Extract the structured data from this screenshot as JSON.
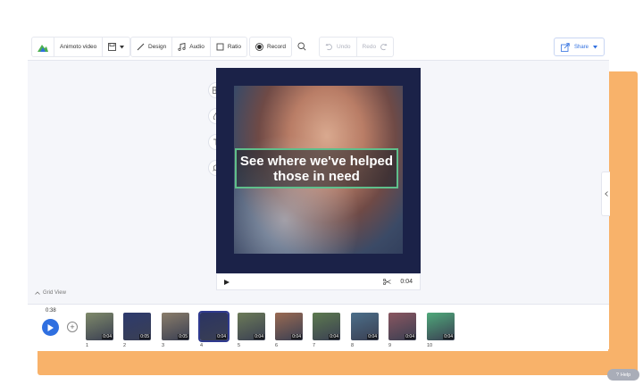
{
  "toolbar": {
    "project_title": "Animoto video",
    "design_label": "Design",
    "audio_label": "Audio",
    "ratio_label": "Ratio",
    "record_label": "Record",
    "undo_label": "Undo",
    "redo_label": "Redo",
    "share_label": "Share"
  },
  "canvas": {
    "caption_line1": "See where we've helped",
    "caption_line2": "those in need",
    "clip_time": "0:04"
  },
  "grid_view_label": "Grid View",
  "timeline": {
    "total_time": "0:38",
    "scenes": [
      {
        "num": "1",
        "duration": "0:04",
        "color": "#7f8a6a"
      },
      {
        "num": "2",
        "duration": "0:05",
        "color": "#2d3a6e"
      },
      {
        "num": "3",
        "duration": "0:05",
        "color": "#8a7d6a"
      },
      {
        "num": "4",
        "duration": "0:04",
        "color": "#2b3463"
      },
      {
        "num": "5",
        "duration": "0:04",
        "color": "#6c7b58"
      },
      {
        "num": "6",
        "duration": "0:04",
        "color": "#9a6a52"
      },
      {
        "num": "7",
        "duration": "0:04",
        "color": "#5d7a4f"
      },
      {
        "num": "8",
        "duration": "0:04",
        "color": "#4c6f8a"
      },
      {
        "num": "9",
        "duration": "0:04",
        "color": "#8a5660"
      },
      {
        "num": "10",
        "duration": "0:04",
        "color": "#4fa97a"
      }
    ]
  },
  "help_label": "Help"
}
